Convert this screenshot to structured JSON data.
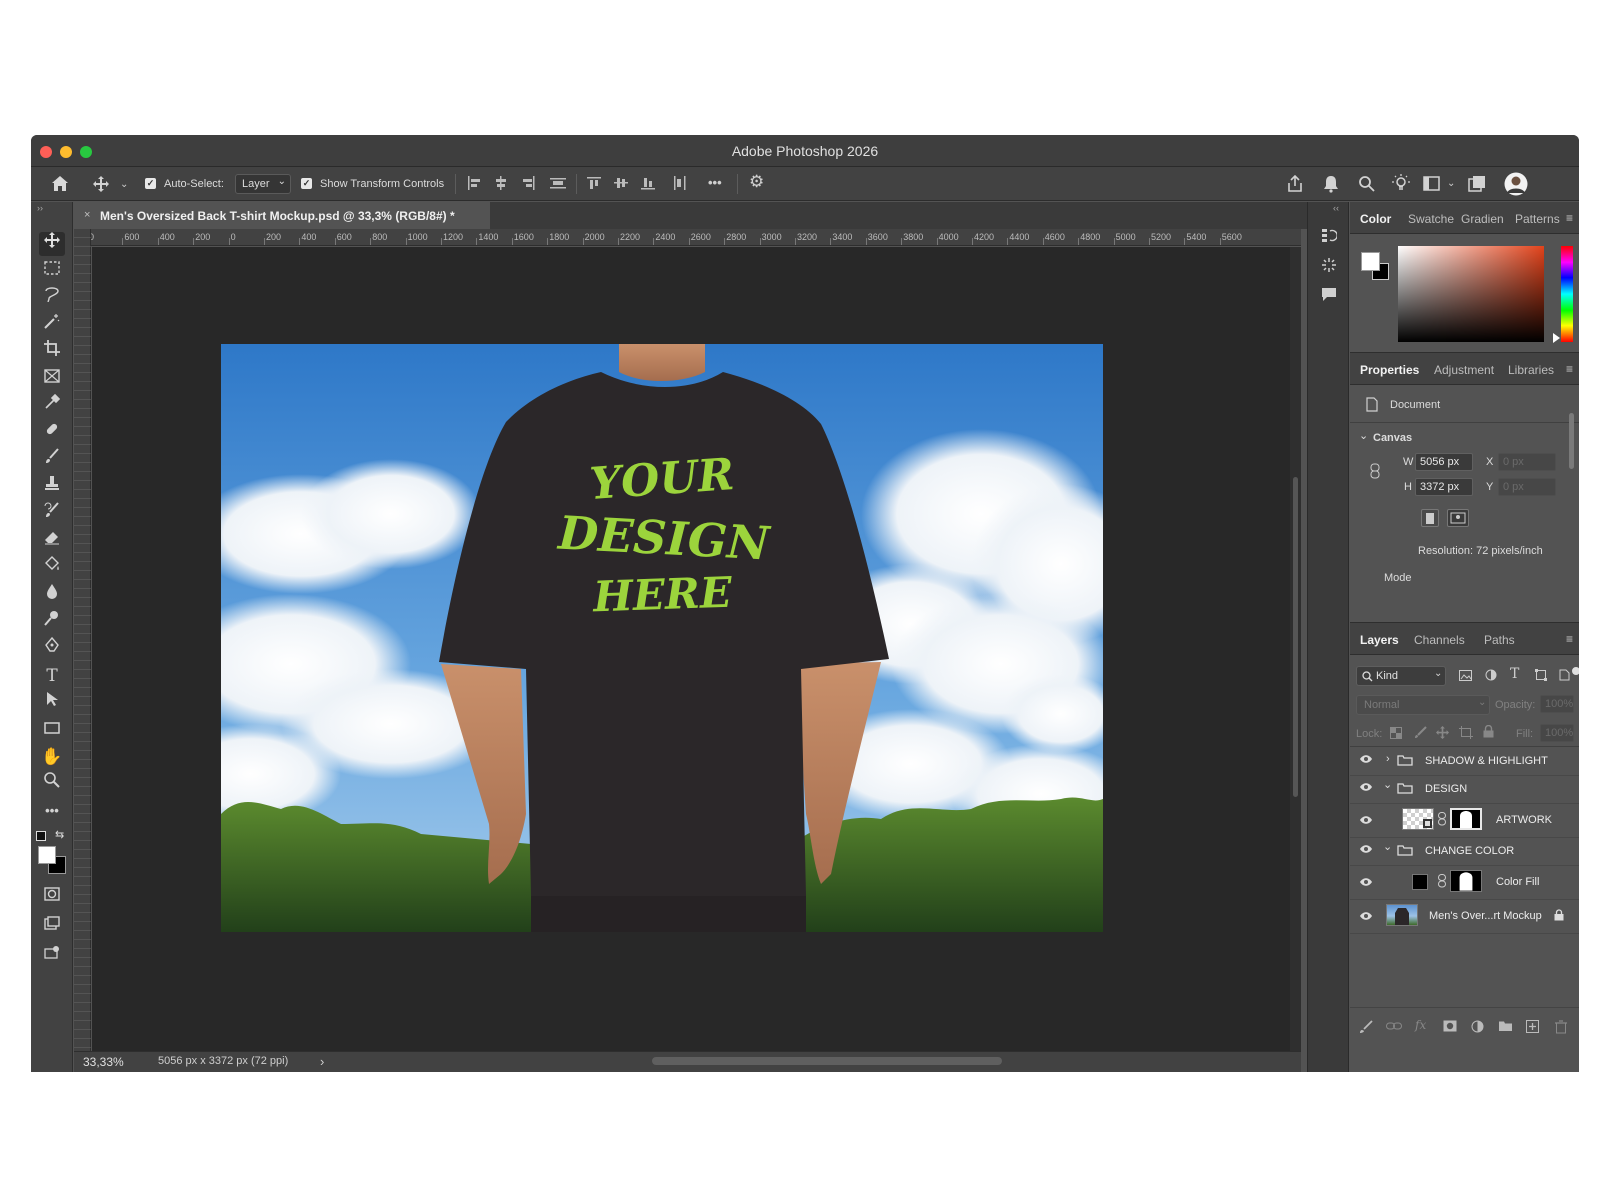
{
  "app": {
    "title": "Adobe Photoshop 2026"
  },
  "options_bar": {
    "auto_select_label": "Auto-Select:",
    "auto_select_value": "Layer",
    "show_transform_label": "Show Transform Controls",
    "more_label": "•••"
  },
  "document": {
    "tab_title": "Men's Oversized Back T-shirt Mockup.psd @ 33,3% (RGB/8#) *",
    "close_glyph": "×",
    "shirt_text": [
      "YOUR",
      "DESIGN",
      "HERE"
    ]
  },
  "ruler": {
    "h_ticks": [
      "0",
      "600",
      "400",
      "200",
      "0",
      "200",
      "400",
      "600",
      "800",
      "1000",
      "1200",
      "1400",
      "1600",
      "1800",
      "2000",
      "2200",
      "2400",
      "2600",
      "2800",
      "3000",
      "3200",
      "3400",
      "3600",
      "3800",
      "4000",
      "4200",
      "4400",
      "4600",
      "4800",
      "5000",
      "5200",
      "5400",
      "5600"
    ]
  },
  "status": {
    "zoom": "33,33%",
    "doc_size": "5056 px x 3372 px (72 ppi)",
    "arrow": "›"
  },
  "color_panel": {
    "tabs": [
      "Color",
      "Swatche",
      "Gradien",
      "Patterns"
    ],
    "foreground": "#ffffff",
    "background": "#000000",
    "hue_color": "#e2431b"
  },
  "properties_panel": {
    "tabs": [
      "Properties",
      "Adjustment",
      "Libraries"
    ],
    "type_label": "Document",
    "section": "Canvas",
    "w_label": "W",
    "w_value": "5056 px",
    "h_label": "H",
    "h_value": "3372 px",
    "x_label": "X",
    "x_value": "0 px",
    "y_label": "Y",
    "y_value": "0 px",
    "resolution": "Resolution: 72 pixels/inch",
    "mode_label": "Mode"
  },
  "layers_panel": {
    "tabs": [
      "Layers",
      "Channels",
      "Paths"
    ],
    "filter_label": "Kind",
    "blend_mode": "Normal",
    "opacity_label": "Opacity:",
    "opacity_value": "100%",
    "lock_label": "Lock:",
    "fill_label": "Fill:",
    "fill_value": "100%",
    "layers": [
      {
        "name": "SHADOW & HIGHLIGHT",
        "kind": "group",
        "expanded": false
      },
      {
        "name": "DESIGN",
        "kind": "group",
        "expanded": true
      },
      {
        "name": "ARTWORK",
        "kind": "smart-object-with-mask"
      },
      {
        "name": "CHANGE COLOR",
        "kind": "group",
        "expanded": true
      },
      {
        "name": "Color Fill",
        "kind": "fill-with-mask"
      },
      {
        "name": "Men's Over...rt Mockup",
        "kind": "background-locked"
      }
    ]
  }
}
